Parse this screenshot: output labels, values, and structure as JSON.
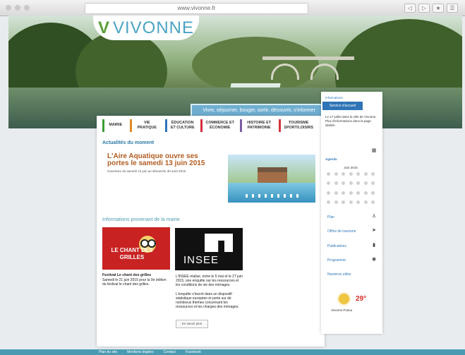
{
  "browser": {
    "address": "www.vivonne.fr",
    "tools": [
      "◁",
      "▷",
      "★",
      "☰"
    ]
  },
  "site": {
    "logo_letter": "V",
    "logo_text": "VIVONNE",
    "search_placeholder": "Vivre, séjourner, bouger, sortir, découvrir, s'informer",
    "brand_color": "#4ba3c3"
  },
  "nav": {
    "items": [
      {
        "label": "MAIRIE",
        "color": "#3c9d35"
      },
      {
        "label": "VIE PRATIQUE",
        "color": "#e08b24"
      },
      {
        "label": "ÉDUCATION ET CULTURE",
        "color": "#2f73ba"
      },
      {
        "label": "COMMERCE ET ÉCONOMIE",
        "color": "#d62f3f"
      },
      {
        "label": "HISTOIRE ET PATRIMOINE",
        "color": "#7b5ca8"
      },
      {
        "label": "TOURISME SPORT/LOISIRS",
        "color": "#d2343b"
      }
    ]
  },
  "main": {
    "news_title": "Actualités du moment",
    "headline": "L'Aire Aquatique ouvre ses portes le samedi 13 juin 2015",
    "headline_sub": "Ouverture du samedi 13 juin au dimanche 30 août 2015",
    "info_title": "Informations provenant de la mairie",
    "img1_text": "LE CHANT DES GRILLES",
    "caption1_title": "Festival Le chant des grilles",
    "caption1": "Samedi le 21 juin 2015 pour la 9e édition du festival le chant des grilles.",
    "insee_text": "INSEE",
    "caption2": "L'INSEE réalise, entre le 5 mai et le 27 juin 2015, une enquête sur les ressources et les conditions de vie des ménages.",
    "caption3": "L'enquête s'inscrit dans un dispositif statistique européen et porte sur de nombreux thèmes concernant les ressources et les charges des ménages.",
    "more_label": "En savoir plus"
  },
  "sidebar": {
    "info_label": "Informations",
    "tab_label": "Service d'accueil",
    "info_text": "Le 17 juillet dans la ville de Vivonne. Plus d'informations dans la page dédiée.",
    "agenda_label": "Agenda",
    "month": "Juin 2015",
    "links": [
      "Plan",
      "Office de tourisme",
      "Publications",
      "Programme",
      "Numéros utiles"
    ],
    "weather_temp": "29°",
    "weather_text": "Vivonne Poitou"
  },
  "footer": {
    "links": [
      "Plan du site",
      "Mentions légales",
      "Contact",
      "Facebook"
    ]
  }
}
